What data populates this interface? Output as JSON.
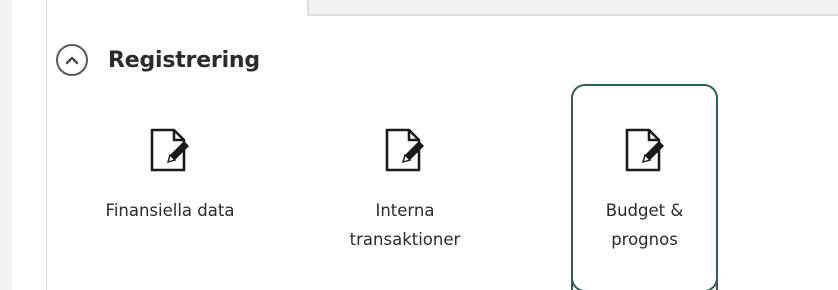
{
  "section": {
    "title": "Registrering",
    "collapse_icon": "chevron-up-icon"
  },
  "tiles": [
    {
      "label_line1": "Finansiella data",
      "label_line2": "",
      "icon": "document-edit-icon"
    },
    {
      "label_line1": "Interna",
      "label_line2": "transaktioner",
      "icon": "document-edit-icon"
    },
    {
      "label_line1": "Budget &",
      "label_line2": "prognos",
      "icon": "document-edit-icon",
      "selected": true
    }
  ],
  "colors": {
    "selected_border": "#2e5e57",
    "text": "#2a2a2a",
    "title": "#2b2b2b"
  }
}
